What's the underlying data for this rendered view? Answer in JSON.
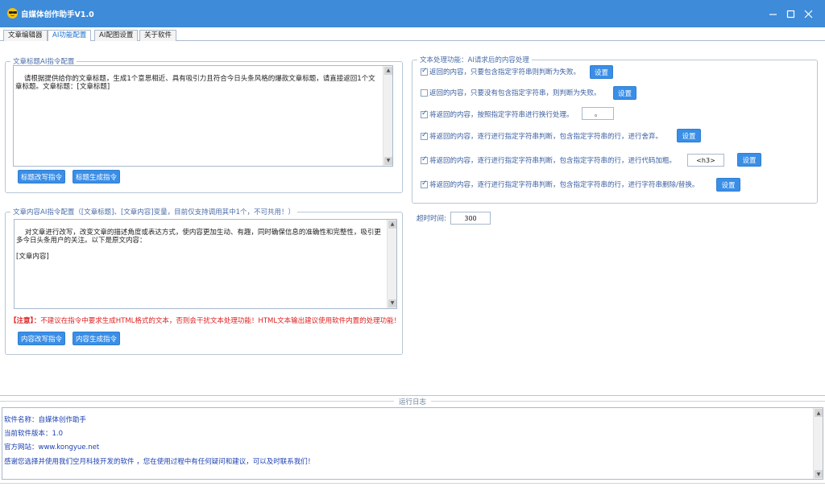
{
  "window": {
    "title": "自媒体创作助手V1.0"
  },
  "tabs": [
    {
      "label": "文章编辑器"
    },
    {
      "label": "AI功能配置"
    },
    {
      "label": "AI配图设置"
    },
    {
      "label": "关于软件"
    }
  ],
  "title_prompt": {
    "legend": "文章标题AI指令配置",
    "text": "请根据提供给你的文章标题，生成1个意思相近、具有吸引力且符合今日头条风格的爆款文章标题，请直接返回1个文章标题。文章标题：[文章标题]",
    "buttons": [
      "标题改写指令",
      "标题生成指令"
    ]
  },
  "content_prompt": {
    "legend": "文章内容AI指令配置（[文章标题]、[文章内容]变量，目前仅支持调用其中1个，不可共用！）",
    "text": "对文章进行改写，改变文章的描述角度或表达方式，使内容更加生动、有趣，同时确保信息的准确性和完整性，吸引更多今日头条用户的关注。以下是原文内容：\n\n[文章内容]",
    "warning_label": "【注意】：",
    "warning_text": "不建议在指令中要求生成HTML格式的文本，否则会干扰文本处理功能！HTML文本输出建议使用软件内置的处理功能！",
    "buttons": [
      "内容改写指令",
      "内容生成指令"
    ]
  },
  "text_processing": {
    "legend": "文本处理功能：AI请求后的内容处理",
    "options": [
      {
        "label": "返回的内容，只要包含指定字符串则判断为失败。",
        "checked": true,
        "button": "设置"
      },
      {
        "label": "返回的内容，只要没有包含指定字符串，则判断为失败。",
        "checked": false,
        "button": "设置"
      },
      {
        "label": "将返回的内容，按照指定字符串进行换行处理。",
        "checked": true,
        "input": "。"
      },
      {
        "label": "将返回的内容，逐行进行指定字符串判断，包含指定字符串的行，进行舍弃。",
        "checked": true,
        "button": "设置"
      },
      {
        "label": "将返回的内容，逐行进行指定字符串判断，包含指定字符串的行，进行代码加粗。",
        "checked": true,
        "input": "<h3>",
        "button": "设置"
      },
      {
        "label": "将返回的内容，逐行进行指定字符串判断，包含指定字符串的行，进行字符串删除/替换。",
        "checked": true,
        "button": "设置"
      }
    ]
  },
  "timeout": {
    "label": "超时时间:",
    "value": "300"
  },
  "log": {
    "title": "运行日志",
    "lines": [
      "软件名称：自媒体创作助手",
      "当前软件版本：1.0",
      "官方网站：www.kongyue.net",
      "感谢您选择并使用我们空月科技开发的软件 ，您在使用过程中有任何疑问和建议，可以及时联系我们！"
    ]
  }
}
